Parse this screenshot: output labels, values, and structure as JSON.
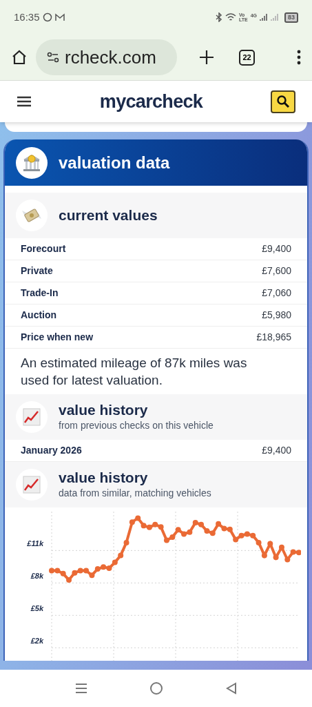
{
  "status_bar": {
    "time": "16:35",
    "network_top": "Vo",
    "network_bottom": "LTE",
    "network_type": "4G",
    "battery": "83"
  },
  "browser": {
    "url": "rcheck.com",
    "tab_count": "22"
  },
  "site_header": {
    "logo": "mycarcheck"
  },
  "valuation": {
    "title": "valuation data",
    "current_values": {
      "title": "current values",
      "rows": [
        {
          "label": "Forecourt",
          "value": "£9,400"
        },
        {
          "label": "Private",
          "value": "£7,600"
        },
        {
          "label": "Trade-In",
          "value": "£7,060"
        },
        {
          "label": "Auction",
          "value": "£5,980"
        },
        {
          "label": "Price when new",
          "value": "£18,965"
        }
      ]
    },
    "note": "An estimated mileage of 87k miles was used for latest valuation.",
    "history": {
      "title": "value history",
      "subtitle": "from previous checks on this vehicle",
      "rows": [
        {
          "label": "January 2026",
          "value": "£9,400"
        }
      ]
    },
    "similar": {
      "title": "value history",
      "subtitle": "data from similar, matching vehicles",
      "chart_data": {
        "type": "line",
        "yticks": [
          {
            "value": 11000,
            "label": "£11k"
          },
          {
            "value": 8000,
            "label": "£8k"
          },
          {
            "value": 5000,
            "label": "£5k"
          },
          {
            "value": 2000,
            "label": "£2k"
          }
        ],
        "ylim": [
          800,
          14600
        ],
        "grid": true,
        "series": [
          {
            "color": "#ea6a35",
            "marker": "circle",
            "values": [
              9140,
              9140,
              8860,
              8280,
              8930,
              9140,
              9140,
              8710,
              9300,
              9470,
              9360,
              9900,
              10550,
              11730,
              13630,
              14000,
              13300,
              13140,
              13400,
              13180,
              11950,
              12230,
              12920,
              12530,
              12700,
              13570,
              13400,
              12810,
              12600,
              13460,
              13030,
              12960,
              12010,
              12380,
              12530,
              12380,
              11730,
              10550,
              11630,
              10370,
              11300,
              10160,
              10870,
              10810
            ]
          }
        ]
      }
    }
  }
}
